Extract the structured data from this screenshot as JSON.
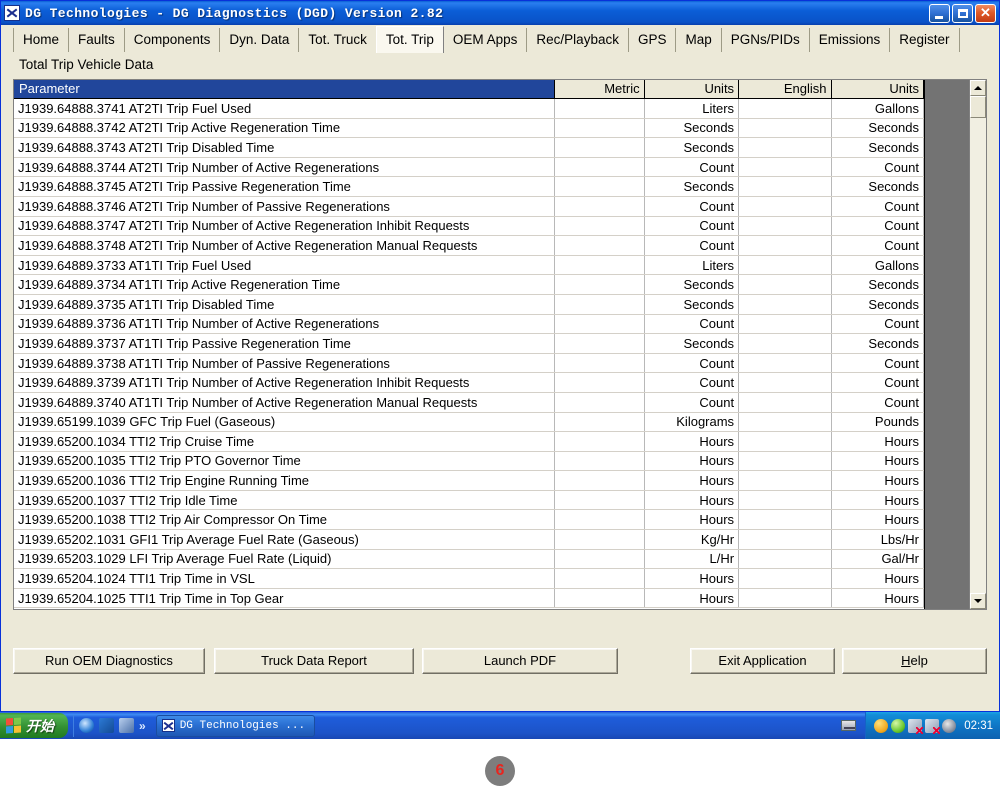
{
  "window": {
    "title": "DG Technologies - DG Diagnostics (DGD) Version 2.82",
    "minimize_label": "Minimize",
    "maximize_label": "Maximize",
    "close_label": "✕"
  },
  "tabs": [
    {
      "label": "Home",
      "active": false
    },
    {
      "label": "Faults",
      "active": false
    },
    {
      "label": "Components",
      "active": false
    },
    {
      "label": "Dyn. Data",
      "active": false
    },
    {
      "label": "Tot. Truck",
      "active": false
    },
    {
      "label": "Tot. Trip",
      "active": true
    },
    {
      "label": "OEM Apps",
      "active": false
    },
    {
      "label": "Rec/Playback",
      "active": false
    },
    {
      "label": "GPS",
      "active": false
    },
    {
      "label": "Map",
      "active": false
    },
    {
      "label": "PGNs/PIDs",
      "active": false
    },
    {
      "label": "Emissions",
      "active": false
    },
    {
      "label": "Register",
      "active": false
    }
  ],
  "page": {
    "heading": "Total Trip Vehicle Data"
  },
  "grid": {
    "columns": [
      "Parameter",
      "Metric",
      "Units",
      "English",
      "Units"
    ],
    "selected_column": "Parameter",
    "rows": [
      {
        "parameter": "J1939.64888.3741 AT2TI Trip Fuel Used",
        "metric": "",
        "metric_units": "Liters",
        "english": "",
        "english_units": "Gallons"
      },
      {
        "parameter": "J1939.64888.3742 AT2TI Trip Active Regeneration Time",
        "metric": "",
        "metric_units": "Seconds",
        "english": "",
        "english_units": "Seconds"
      },
      {
        "parameter": "J1939.64888.3743 AT2TI Trip Disabled Time",
        "metric": "",
        "metric_units": "Seconds",
        "english": "",
        "english_units": "Seconds"
      },
      {
        "parameter": "J1939.64888.3744 AT2TI Trip Number of Active Regenerations",
        "metric": "",
        "metric_units": "Count",
        "english": "",
        "english_units": "Count"
      },
      {
        "parameter": "J1939.64888.3745 AT2TI Trip Passive Regeneration Time",
        "metric": "",
        "metric_units": "Seconds",
        "english": "",
        "english_units": "Seconds"
      },
      {
        "parameter": "J1939.64888.3746 AT2TI Trip Number of Passive Regenerations",
        "metric": "",
        "metric_units": "Count",
        "english": "",
        "english_units": "Count"
      },
      {
        "parameter": "J1939.64888.3747 AT2TI Trip Number of Active Regeneration Inhibit Requests",
        "metric": "",
        "metric_units": "Count",
        "english": "",
        "english_units": "Count"
      },
      {
        "parameter": "J1939.64888.3748 AT2TI Trip Number of Active Regeneration Manual Requests",
        "metric": "",
        "metric_units": "Count",
        "english": "",
        "english_units": "Count"
      },
      {
        "parameter": "J1939.64889.3733 AT1TI Trip Fuel Used",
        "metric": "",
        "metric_units": "Liters",
        "english": "",
        "english_units": "Gallons"
      },
      {
        "parameter": "J1939.64889.3734 AT1TI Trip Active Regeneration Time",
        "metric": "",
        "metric_units": "Seconds",
        "english": "",
        "english_units": "Seconds"
      },
      {
        "parameter": "J1939.64889.3735 AT1TI Trip Disabled Time",
        "metric": "",
        "metric_units": "Seconds",
        "english": "",
        "english_units": "Seconds"
      },
      {
        "parameter": "J1939.64889.3736 AT1TI Trip Number of Active Regenerations",
        "metric": "",
        "metric_units": "Count",
        "english": "",
        "english_units": "Count"
      },
      {
        "parameter": "J1939.64889.3737 AT1TI Trip Passive Regeneration Time",
        "metric": "",
        "metric_units": "Seconds",
        "english": "",
        "english_units": "Seconds"
      },
      {
        "parameter": "J1939.64889.3738 AT1TI Trip Number of Passive Regenerations",
        "metric": "",
        "metric_units": "Count",
        "english": "",
        "english_units": "Count"
      },
      {
        "parameter": "J1939.64889.3739 AT1TI Trip Number of Active Regeneration Inhibit Requests",
        "metric": "",
        "metric_units": "Count",
        "english": "",
        "english_units": "Count"
      },
      {
        "parameter": "J1939.64889.3740 AT1TI Trip Number of Active Regeneration Manual Requests",
        "metric": "",
        "metric_units": "Count",
        "english": "",
        "english_units": "Count"
      },
      {
        "parameter": "J1939.65199.1039 GFC   Trip Fuel (Gaseous)",
        "metric": "",
        "metric_units": "Kilograms",
        "english": "",
        "english_units": "Pounds"
      },
      {
        "parameter": "J1939.65200.1034 TTI2  Trip Cruise Time",
        "metric": "",
        "metric_units": "Hours",
        "english": "",
        "english_units": "Hours"
      },
      {
        "parameter": "J1939.65200.1035 TTI2  Trip PTO Governor Time",
        "metric": "",
        "metric_units": "Hours",
        "english": "",
        "english_units": "Hours"
      },
      {
        "parameter": "J1939.65200.1036 TTI2  Trip Engine Running Time",
        "metric": "",
        "metric_units": "Hours",
        "english": "",
        "english_units": "Hours"
      },
      {
        "parameter": "J1939.65200.1037 TTI2  Trip Idle Time",
        "metric": "",
        "metric_units": "Hours",
        "english": "",
        "english_units": "Hours"
      },
      {
        "parameter": "J1939.65200.1038 TTI2  Trip Air Compressor On Time",
        "metric": "",
        "metric_units": "Hours",
        "english": "",
        "english_units": "Hours"
      },
      {
        "parameter": "J1939.65202.1031 GFI1  Trip Average Fuel Rate (Gaseous)",
        "metric": "",
        "metric_units": "Kg/Hr",
        "english": "",
        "english_units": "Lbs/Hr"
      },
      {
        "parameter": "J1939.65203.1029 LFI   Trip Average Fuel Rate (Liquid)",
        "metric": "",
        "metric_units": "L/Hr",
        "english": "",
        "english_units": "Gal/Hr"
      },
      {
        "parameter": "J1939.65204.1024 TTI1  Trip Time in VSL",
        "metric": "",
        "metric_units": "Hours",
        "english": "",
        "english_units": "Hours"
      },
      {
        "parameter": "J1939.65204.1025 TTI1  Trip Time in Top Gear",
        "metric": "",
        "metric_units": "Hours",
        "english": "",
        "english_units": "Hours"
      }
    ]
  },
  "footer": {
    "run_oem_diagnostics": "Run OEM Diagnostics",
    "truck_data_report": "Truck Data Report",
    "launch_pdf": "Launch PDF",
    "exit_application": "Exit Application",
    "help_accel": "H",
    "help_rest": "elp"
  },
  "taskbar": {
    "start_label": "开始",
    "quicklaunch_chevron": "»",
    "task_button_label": "DG Technologies ...",
    "clock": "02:31"
  },
  "badge": {
    "number": "6"
  }
}
